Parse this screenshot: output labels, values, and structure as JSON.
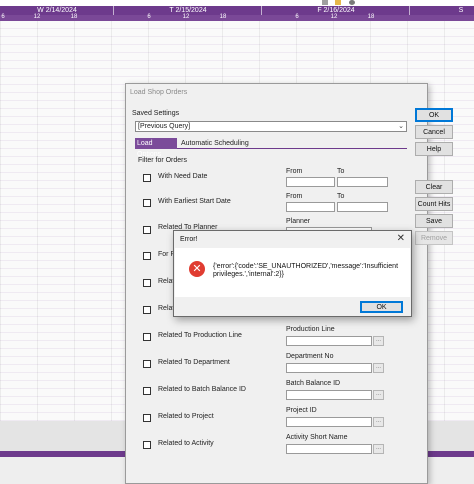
{
  "gantt": {
    "dates": [
      "W 2/14/2024",
      "T 2/15/2024",
      "F 2/16/2024",
      "S"
    ],
    "hours": [
      "6",
      "12",
      "18",
      "6",
      "12",
      "18",
      "6",
      "12",
      "18"
    ]
  },
  "dialog": {
    "title": "Load Shop Orders",
    "saved_settings_label": "Saved Settings",
    "saved_settings_value": "[Previous Query]",
    "tabs": [
      "Load Options",
      "Automatic Scheduling"
    ],
    "filter_heading": "Filter for Orders",
    "buttons": {
      "ok": "OK",
      "cancel": "Cancel",
      "help": "Help",
      "clear": "Clear",
      "count_hits": "Count Hits",
      "save": "Save",
      "remove": "Remove"
    },
    "filters": [
      {
        "label": "With Need Date"
      },
      {
        "label": "With Earliest Start Date"
      },
      {
        "label": "Related To Planner"
      },
      {
        "label": "For Pa"
      },
      {
        "label": "Relat"
      },
      {
        "label": "Relat"
      },
      {
        "label": "Related To Production Line"
      },
      {
        "label": "Related To Department"
      },
      {
        "label": "Related to Batch Balance ID"
      },
      {
        "label": "Related to Project"
      },
      {
        "label": "Related to Activity"
      }
    ],
    "field_labels": {
      "from": "From",
      "to": "To",
      "planner": "Planner",
      "production_line": "Production Line",
      "department_no": "Department No",
      "batch_balance_id": "Batch Balance ID",
      "project_id": "Project ID",
      "activity_short_name": "Activity Short Name"
    },
    "ellipsis": "..."
  },
  "error_dialog": {
    "title": "Error!",
    "message": "{'error':{'code':'SE_UNAUTHORIZED','message':'Insufficient privileges.','internal':2}}",
    "ok_label": "OK",
    "close_glyph": "✕",
    "icon_glyph": "✕"
  },
  "colors": {
    "accent": "#6d3a8c",
    "error": "#e03c31"
  }
}
